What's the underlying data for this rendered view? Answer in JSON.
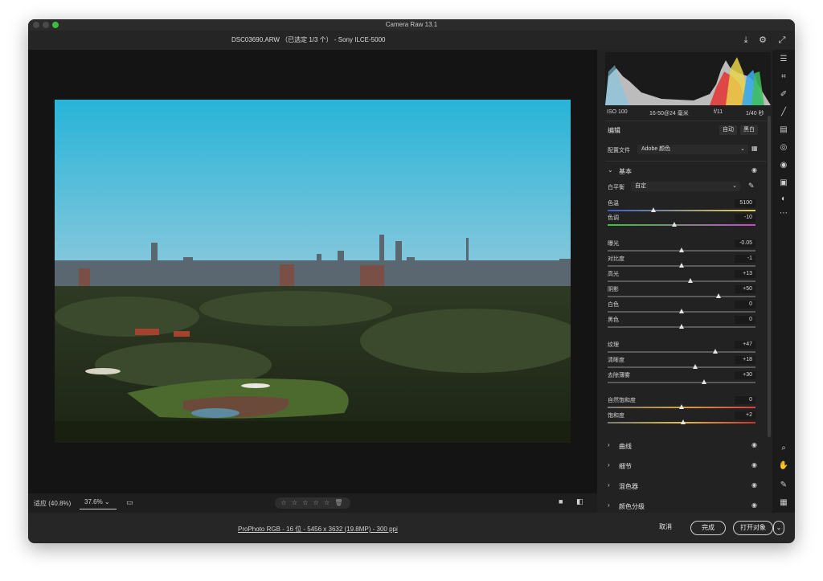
{
  "window": {
    "title": "Camera Raw 13.1"
  },
  "header": {
    "file_info": "DSC03690.ARW （已选定 1/3 个） - Sony ILCE-5000"
  },
  "bottom": {
    "zoom_fit": "适应 (40.8%)",
    "zoom_value": "37.6%",
    "stars": "☆ ☆ ☆ ☆ ☆  🗑"
  },
  "panel": {
    "camera_info": {
      "iso": "ISO 100",
      "lens": "16-50@24 毫米",
      "aperture": "f/11",
      "shutter": "1/40 秒"
    },
    "edit_title": "编辑",
    "auto_button": "自动",
    "bw_button": "黑白",
    "profile_label": "配置文件",
    "profile_value": "Adobe 颜色",
    "basic_section": "基本",
    "wb_label": "白平衡",
    "wb_value": "自定",
    "sliders": [
      {
        "label": "色温",
        "value": "5100",
        "pos": 0.31,
        "color": "temp"
      },
      {
        "label": "色调",
        "value": "-10",
        "pos": 0.45,
        "color": "tint"
      },
      {
        "label": "曝光",
        "value": "-0.05",
        "pos": 0.5,
        "color": "plain"
      },
      {
        "label": "对比度",
        "value": "-1",
        "pos": 0.5,
        "color": "plain"
      },
      {
        "label": "高光",
        "value": "+13",
        "pos": 0.56,
        "color": "plain"
      },
      {
        "label": "阴影",
        "value": "+50",
        "pos": 0.75,
        "color": "plain"
      },
      {
        "label": "白色",
        "value": "0",
        "pos": 0.5,
        "color": "plain"
      },
      {
        "label": "黑色",
        "value": "0",
        "pos": 0.5,
        "color": "plain"
      },
      {
        "label": "纹理",
        "value": "+47",
        "pos": 0.73,
        "color": "plain"
      },
      {
        "label": "清晰度",
        "value": "+18",
        "pos": 0.59,
        "color": "plain"
      },
      {
        "label": "去除薄雾",
        "value": "+30",
        "pos": 0.65,
        "color": "plain"
      },
      {
        "label": "自然饱和度",
        "value": "0",
        "pos": 0.5,
        "color": "vib"
      },
      {
        "label": "饱和度",
        "value": "+2",
        "pos": 0.51,
        "color": "sat"
      }
    ],
    "sections": [
      "曲线",
      "细节",
      "混色器",
      "颜色分级"
    ]
  },
  "footer": {
    "color_info": "ProPhoto RGB - 16 位 - 5456 x 3632 (19.8MP) - 300 ppi",
    "cancel": "取消",
    "done": "完成",
    "open": "打开对象"
  },
  "colors": {
    "accent_green": "#3fbb41",
    "sky_top": "#27b4d8",
    "sky_bottom": "#bccfd9"
  }
}
